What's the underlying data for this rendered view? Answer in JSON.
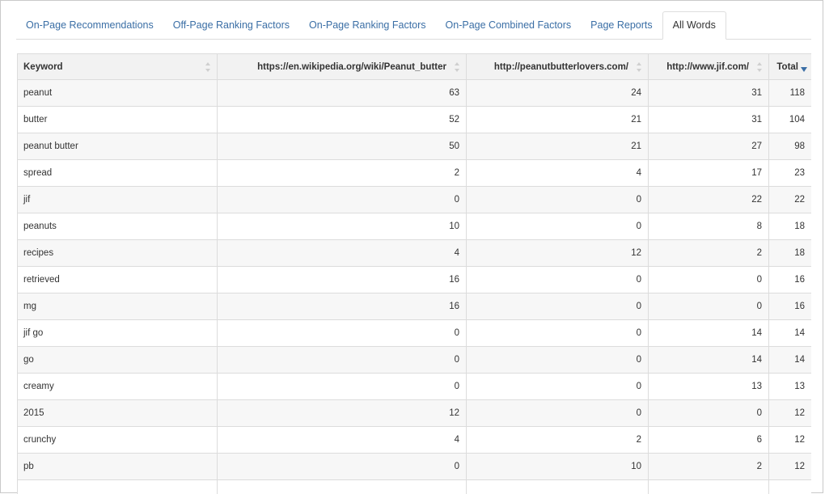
{
  "tabs": [
    {
      "label": "On-Page Recommendations",
      "active": false
    },
    {
      "label": "Off-Page Ranking Factors",
      "active": false
    },
    {
      "label": "On-Page Ranking Factors",
      "active": false
    },
    {
      "label": "On-Page Combined Factors",
      "active": false
    },
    {
      "label": "Page Reports",
      "active": false
    },
    {
      "label": "All Words",
      "active": true
    }
  ],
  "table": {
    "columns": [
      {
        "label": "Keyword",
        "sort": "none"
      },
      {
        "label": "https://en.wikipedia.org/wiki/Peanut_butter",
        "sort": "none"
      },
      {
        "label": "http://peanutbutterlovers.com/",
        "sort": "none"
      },
      {
        "label": "http://www.jif.com/",
        "sort": "none"
      },
      {
        "label": "Total",
        "sort": "desc"
      }
    ],
    "rows": [
      [
        "peanut",
        "63",
        "24",
        "31",
        "118"
      ],
      [
        "butter",
        "52",
        "21",
        "31",
        "104"
      ],
      [
        "peanut butter",
        "50",
        "21",
        "27",
        "98"
      ],
      [
        "spread",
        "2",
        "4",
        "17",
        "23"
      ],
      [
        "jif",
        "0",
        "0",
        "22",
        "22"
      ],
      [
        "peanuts",
        "10",
        "0",
        "8",
        "18"
      ],
      [
        "recipes",
        "4",
        "12",
        "2",
        "18"
      ],
      [
        "retrieved",
        "16",
        "0",
        "0",
        "16"
      ],
      [
        "mg",
        "16",
        "0",
        "0",
        "16"
      ],
      [
        "jif go",
        "0",
        "0",
        "14",
        "14"
      ],
      [
        "go",
        "0",
        "0",
        "14",
        "14"
      ],
      [
        "creamy",
        "0",
        "0",
        "13",
        "13"
      ],
      [
        "2015",
        "12",
        "0",
        "0",
        "12"
      ],
      [
        "crunchy",
        "4",
        "2",
        "6",
        "12"
      ],
      [
        "pb",
        "0",
        "10",
        "2",
        "12"
      ],
      [
        "",
        "",
        "",
        "",
        ""
      ]
    ]
  },
  "colors": {
    "tab_link": "#3a6ea5",
    "header_bg": "#f2f2f2",
    "row_alt_bg": "#f7f7f7",
    "border": "#dcdcdc",
    "sort_active": "#3a6ea5"
  }
}
